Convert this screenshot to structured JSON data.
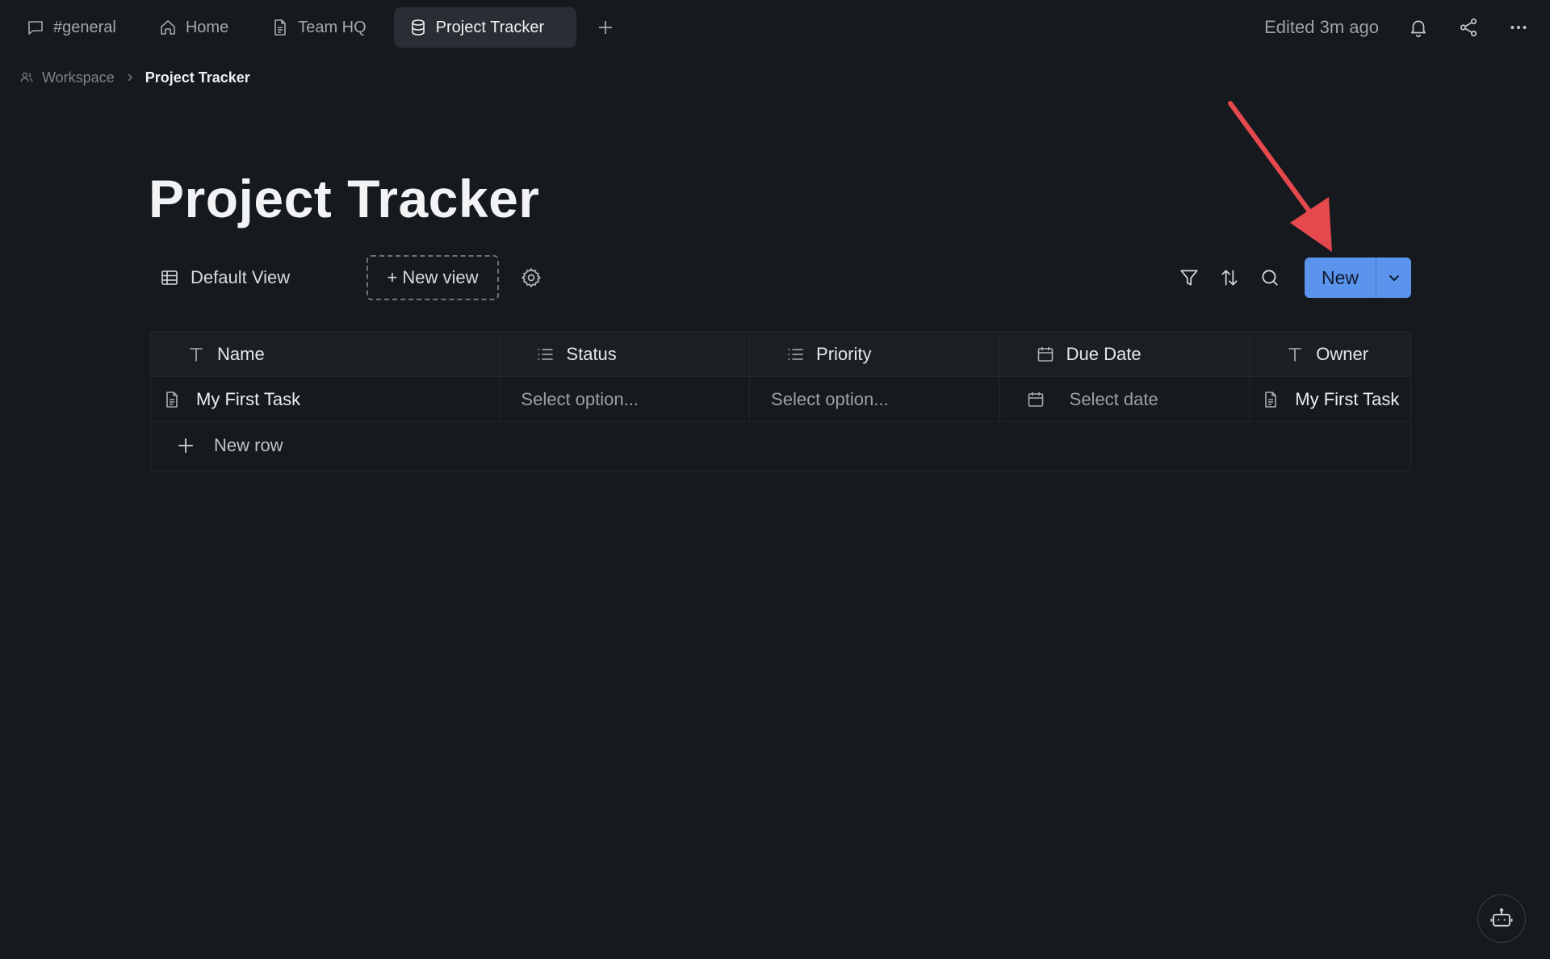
{
  "tabs": [
    {
      "label": "#general",
      "icon": "chat-icon",
      "active": false
    },
    {
      "label": "Home",
      "icon": "home-icon",
      "active": false
    },
    {
      "label": "Team HQ",
      "icon": "document-icon",
      "active": false
    },
    {
      "label": "Project Tracker",
      "icon": "database-icon",
      "active": true
    }
  ],
  "header": {
    "edited_text": "Edited 3m ago",
    "icons": [
      "bell-icon",
      "share-icon",
      "more-icon"
    ]
  },
  "breadcrumb": {
    "items": [
      {
        "label": "Workspace",
        "icon": "people-icon"
      },
      {
        "label": "Project Tracker"
      }
    ]
  },
  "page": {
    "title": "Project Tracker"
  },
  "views": {
    "default_label": "Default View",
    "new_view_label": "+ New view",
    "new_button_label": "New"
  },
  "table": {
    "columns": [
      {
        "label": "Name",
        "icon": "text-type-icon"
      },
      {
        "label": "Status",
        "icon": "list-icon"
      },
      {
        "label": "Priority",
        "icon": "list-icon"
      },
      {
        "label": "Due Date",
        "icon": "calendar-icon"
      },
      {
        "label": "Owner",
        "icon": "text-type-icon"
      }
    ],
    "rows": [
      {
        "name": "My First Task",
        "status": "Select option...",
        "priority": "Select option...",
        "due_date": "Select date",
        "owner": "My First Task"
      }
    ],
    "new_row_label": "New row"
  },
  "colors": {
    "background": "#16191d",
    "accent": "#5a94ec",
    "annotation_arrow": "#e5484d"
  }
}
